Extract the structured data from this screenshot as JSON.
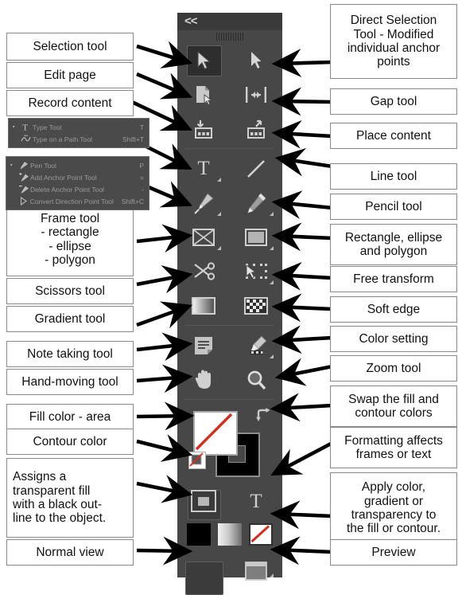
{
  "panel": {
    "collapse_label": "<<",
    "grip_name": "panel-drag-grip",
    "tools": [
      {
        "id": "selection",
        "name": "selection-tool",
        "selected": true,
        "flyout": false
      },
      {
        "id": "direct-selection",
        "name": "direct-selection-tool",
        "selected": false,
        "flyout": false
      },
      {
        "id": "page",
        "name": "page-tool",
        "selected": false,
        "flyout": false
      },
      {
        "id": "gap",
        "name": "gap-tool",
        "selected": false,
        "flyout": false
      },
      {
        "id": "content-collector",
        "name": "content-collector-tool",
        "selected": false,
        "flyout": false
      },
      {
        "id": "content-placer",
        "name": "content-placer-tool",
        "selected": false,
        "flyout": false
      },
      {
        "id": "type",
        "name": "type-tool",
        "selected": false,
        "flyout": true
      },
      {
        "id": "line",
        "name": "line-tool",
        "selected": false,
        "flyout": false
      },
      {
        "id": "pen",
        "name": "pen-tool",
        "selected": false,
        "flyout": true
      },
      {
        "id": "pencil",
        "name": "pencil-tool",
        "selected": false,
        "flyout": true
      },
      {
        "id": "frame",
        "name": "rectangle-frame-tool",
        "selected": false,
        "flyout": true
      },
      {
        "id": "rectangle",
        "name": "rectangle-tool",
        "selected": false,
        "flyout": true
      },
      {
        "id": "scissors",
        "name": "scissors-tool",
        "selected": false,
        "flyout": false
      },
      {
        "id": "free-transform",
        "name": "free-transform-tool",
        "selected": false,
        "flyout": true
      },
      {
        "id": "gradient-swatch",
        "name": "gradient-swatch-tool",
        "selected": false,
        "flyout": false
      },
      {
        "id": "gradient-feather",
        "name": "gradient-feather-tool",
        "selected": false,
        "flyout": false
      },
      {
        "id": "note",
        "name": "note-tool",
        "selected": false,
        "flyout": false
      },
      {
        "id": "eyedropper",
        "name": "eyedropper-tool",
        "selected": false,
        "flyout": true
      },
      {
        "id": "hand",
        "name": "hand-tool",
        "selected": false,
        "flyout": false
      },
      {
        "id": "zoom",
        "name": "zoom-tool",
        "selected": false,
        "flyout": false
      }
    ],
    "fill_stroke": {
      "fill_name": "fill-swatch-none",
      "stroke_name": "stroke-swatch-black",
      "swap_name": "swap-fill-stroke-icon",
      "default_name": "default-fill-stroke-swatch"
    },
    "format_targets": [
      {
        "id": "container",
        "name": "formatting-affects-container",
        "selected": true
      },
      {
        "id": "text",
        "name": "formatting-affects-text",
        "selected": false,
        "glyph": "T"
      }
    ],
    "apply_swatches": [
      {
        "id": "color",
        "name": "apply-color-swatch"
      },
      {
        "id": "gradient",
        "name": "apply-gradient-swatch"
      },
      {
        "id": "none",
        "name": "apply-none-swatch"
      }
    ],
    "view_modes": [
      {
        "id": "normal",
        "name": "normal-view-mode-button",
        "selected": true,
        "flyout": false
      },
      {
        "id": "preview",
        "name": "preview-mode-button",
        "selected": false,
        "flyout": true
      }
    ]
  },
  "flyouts": [
    {
      "id": "type-flyout",
      "items": [
        {
          "bullet": "▪",
          "icon": "type-tool-icon",
          "label": "Type Tool",
          "key": "T"
        },
        {
          "bullet": "",
          "icon": "type-on-path-icon",
          "label": "Type on a Path Tool",
          "key": "Shift+T"
        }
      ]
    },
    {
      "id": "pen-flyout",
      "items": [
        {
          "bullet": "▪",
          "icon": "pen-tool-icon",
          "label": "Pen Tool",
          "key": "P"
        },
        {
          "bullet": "",
          "icon": "add-anchor-point-icon",
          "label": "Add Anchor Point Tool",
          "key": "="
        },
        {
          "bullet": "",
          "icon": "delete-anchor-point-icon",
          "label": "Delete Anchor Point Tool",
          "key": "-"
        },
        {
          "bullet": "",
          "icon": "convert-direction-icon",
          "label": "Convert Direction Point Tool",
          "key": "Shift+C"
        }
      ]
    }
  ],
  "callouts_left": [
    {
      "id": "selection-tool",
      "name": "callout-selection-tool",
      "text": "Selection tool"
    },
    {
      "id": "edit-page",
      "name": "callout-edit-page",
      "text": "Edit page"
    },
    {
      "id": "record-content",
      "name": "callout-record-content",
      "text": "Record content"
    },
    {
      "id": "frame-tool",
      "name": "callout-frame-tool",
      "text": "Frame tool\n- rectangle\n- ellipse\n- polygon"
    },
    {
      "id": "scissors-tool",
      "name": "callout-scissors-tool",
      "text": "Scissors tool"
    },
    {
      "id": "gradient-tool",
      "name": "callout-gradient-tool",
      "text": "Gradient tool"
    },
    {
      "id": "note-taking-tool",
      "name": "callout-note-taking-tool",
      "text": "Note taking tool"
    },
    {
      "id": "hand-moving-tool",
      "name": "callout-hand-moving-tool",
      "text": "Hand-moving tool"
    },
    {
      "id": "fill-color-area",
      "name": "callout-fill-color-area",
      "text": "Fill color - area"
    },
    {
      "id": "contour-color",
      "name": "callout-contour-color",
      "text": "Contour color"
    },
    {
      "id": "transparent-fill",
      "name": "callout-transparent-fill",
      "text": "Assigns a\ntransparent fill\nwith a black out-\nline to the object."
    },
    {
      "id": "normal-view",
      "name": "callout-normal-view",
      "text": "Normal view"
    }
  ],
  "callouts_right": [
    {
      "id": "direct-selection",
      "name": "callout-direct-selection-tool",
      "text": "Direct Selection\nTool - Modified\nindividual anchor\npoints"
    },
    {
      "id": "gap-tool",
      "name": "callout-gap-tool",
      "text": "Gap tool"
    },
    {
      "id": "place-content",
      "name": "callout-place-content",
      "text": "Place content"
    },
    {
      "id": "line-tool",
      "name": "callout-line-tool",
      "text": "Line tool"
    },
    {
      "id": "pencil-tool",
      "name": "callout-pencil-tool",
      "text": "Pencil tool"
    },
    {
      "id": "rect-ellipse-poly",
      "name": "callout-rectangle-ellipse-polygon",
      "text": "Rectangle, ellipse\nand polygon"
    },
    {
      "id": "free-transform",
      "name": "callout-free-transform",
      "text": "Free transform"
    },
    {
      "id": "soft-edge",
      "name": "callout-soft-edge",
      "text": "Soft edge"
    },
    {
      "id": "color-setting",
      "name": "callout-color-setting",
      "text": "Color setting"
    },
    {
      "id": "zoom-tool",
      "name": "callout-zoom-tool",
      "text": "Zoom tool"
    },
    {
      "id": "swap-colors",
      "name": "callout-swap-colors",
      "text": "Swap the fill and\ncontour colors"
    },
    {
      "id": "formatting-affects",
      "name": "callout-formatting-affects",
      "text": "Formatting affects\nframes or text"
    },
    {
      "id": "apply-color",
      "name": "callout-apply-color",
      "text": "Apply color,\ngradient or\ntransparency to\nthe fill or contour."
    },
    {
      "id": "preview",
      "name": "callout-preview",
      "text": "Preview"
    }
  ],
  "colors": {
    "panel_bg": "#474747",
    "panel_head": "#3a3a3a",
    "icon": "#cfcfcf",
    "selected_cell": "#2e2e2e",
    "callout_border": "#8a8a8a",
    "none_slash": "#d92b1c",
    "arrow": "#000000"
  }
}
